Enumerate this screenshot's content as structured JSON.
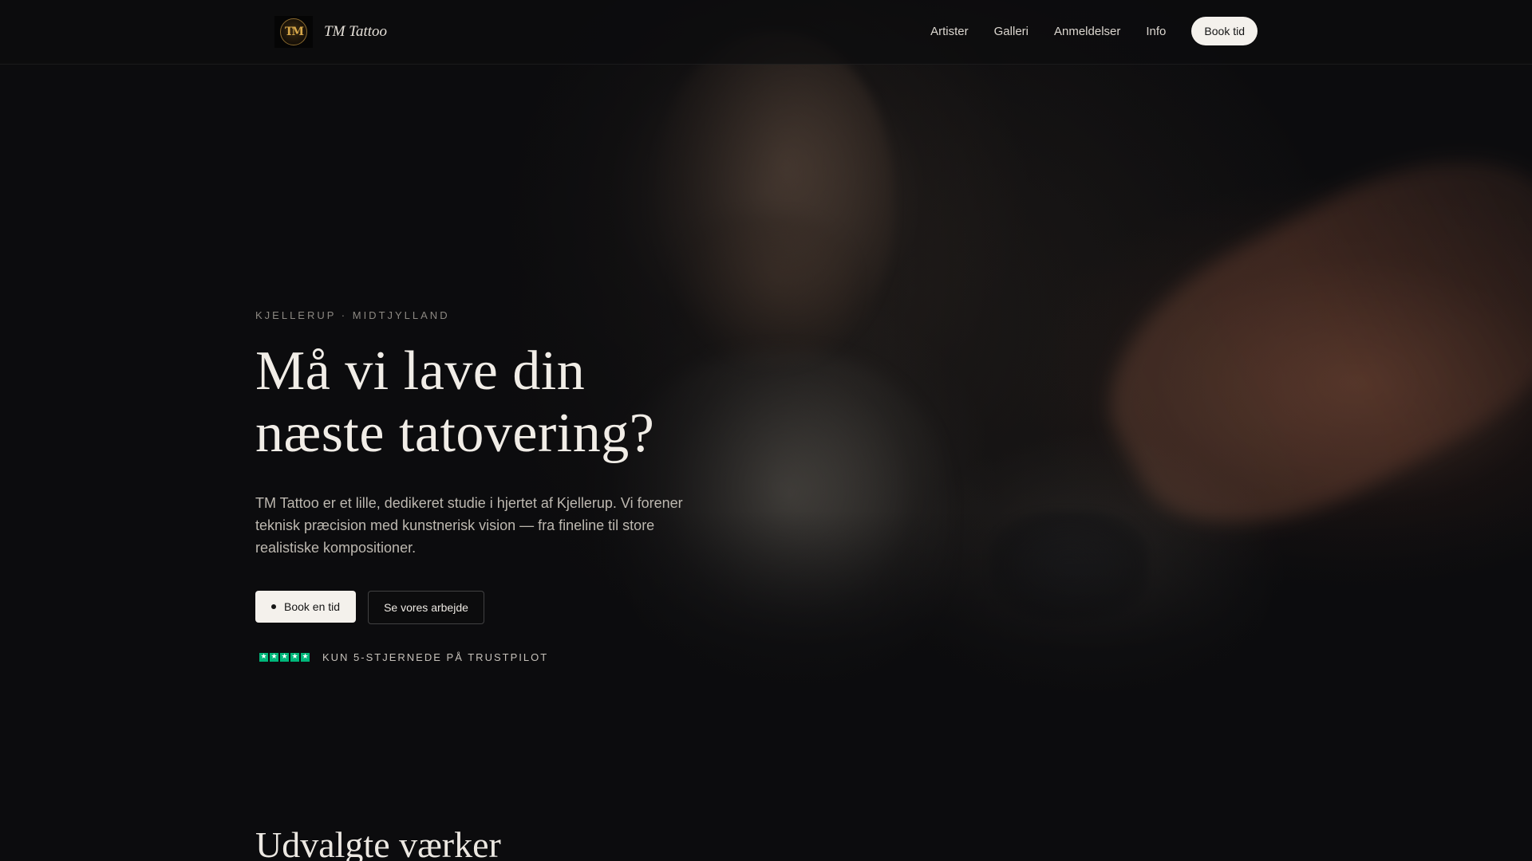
{
  "brand": {
    "name": "TM Tattoo",
    "logo_monogram": "TM",
    "logo_icon": "tm-monogram-logo"
  },
  "nav": {
    "links": [
      "Artister",
      "Galleri",
      "Anmeldelser",
      "Info"
    ],
    "cta_label": "Book tid"
  },
  "hero": {
    "kicker": "KJELLERUP · MIDTJYLLAND",
    "headline_line1": "Må vi lave din",
    "headline_line2": "næste tatovering?",
    "lead": "TM Tattoo er et lille, dedikeret studie i hjertet af Kjellerup. Vi forener teknisk præcision med kunstnerisk vision — fra fineline til store realistiske kompositioner.",
    "primary_cta": "Book en tid",
    "secondary_cta": "Se vores arbejde",
    "trust_text": "KUN 5-STJERNEDE PÅ TRUSTPILOT",
    "rating_stars": 5
  },
  "featured": {
    "title": "Udvalgte værker"
  },
  "colors": {
    "background": "#0c0c0e",
    "trustpilot_green": "#00b67a",
    "button_light": "#f4f1ec",
    "logo_gold": "#d7a84a"
  }
}
